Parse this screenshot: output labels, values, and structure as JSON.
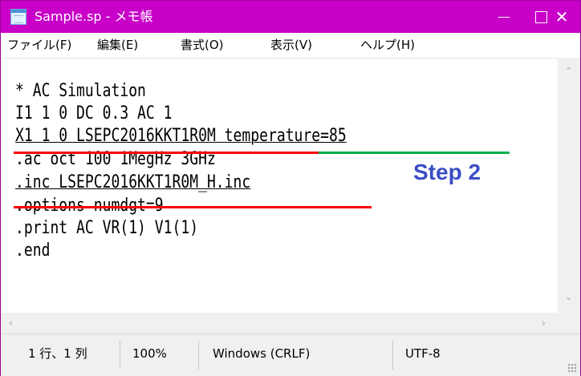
{
  "window": {
    "title": "Sample.sp - メモ帳",
    "colors": {
      "titlebar": "#c800c8",
      "annotation_red": "#ff0000",
      "annotation_green": "#00b050",
      "step_label": "#3b4ec4"
    }
  },
  "menu": {
    "items": [
      "ファイル(F)",
      "編集(E)",
      "書式(O)",
      "表示(V)",
      "ヘルプ(H)"
    ]
  },
  "editor": {
    "lines": [
      "* AC Simulation",
      "I1 1 0 DC 0.3 AC 1",
      "X1 1 0 LSEPC2016KKT1R0M temperature=85",
      ".ac oct 100 1MegHz 3GHz",
      ".inc LSEPC2016KKT1R0M_H.inc",
      ".options numdgt=9",
      ".print AC VR(1) V1(1)",
      ".end"
    ]
  },
  "annotation": {
    "step_label": "Step 2"
  },
  "status": {
    "position": "1 行、1 列",
    "zoom": "100%",
    "line_ending": "Windows (CRLF)",
    "encoding": "UTF-8"
  }
}
